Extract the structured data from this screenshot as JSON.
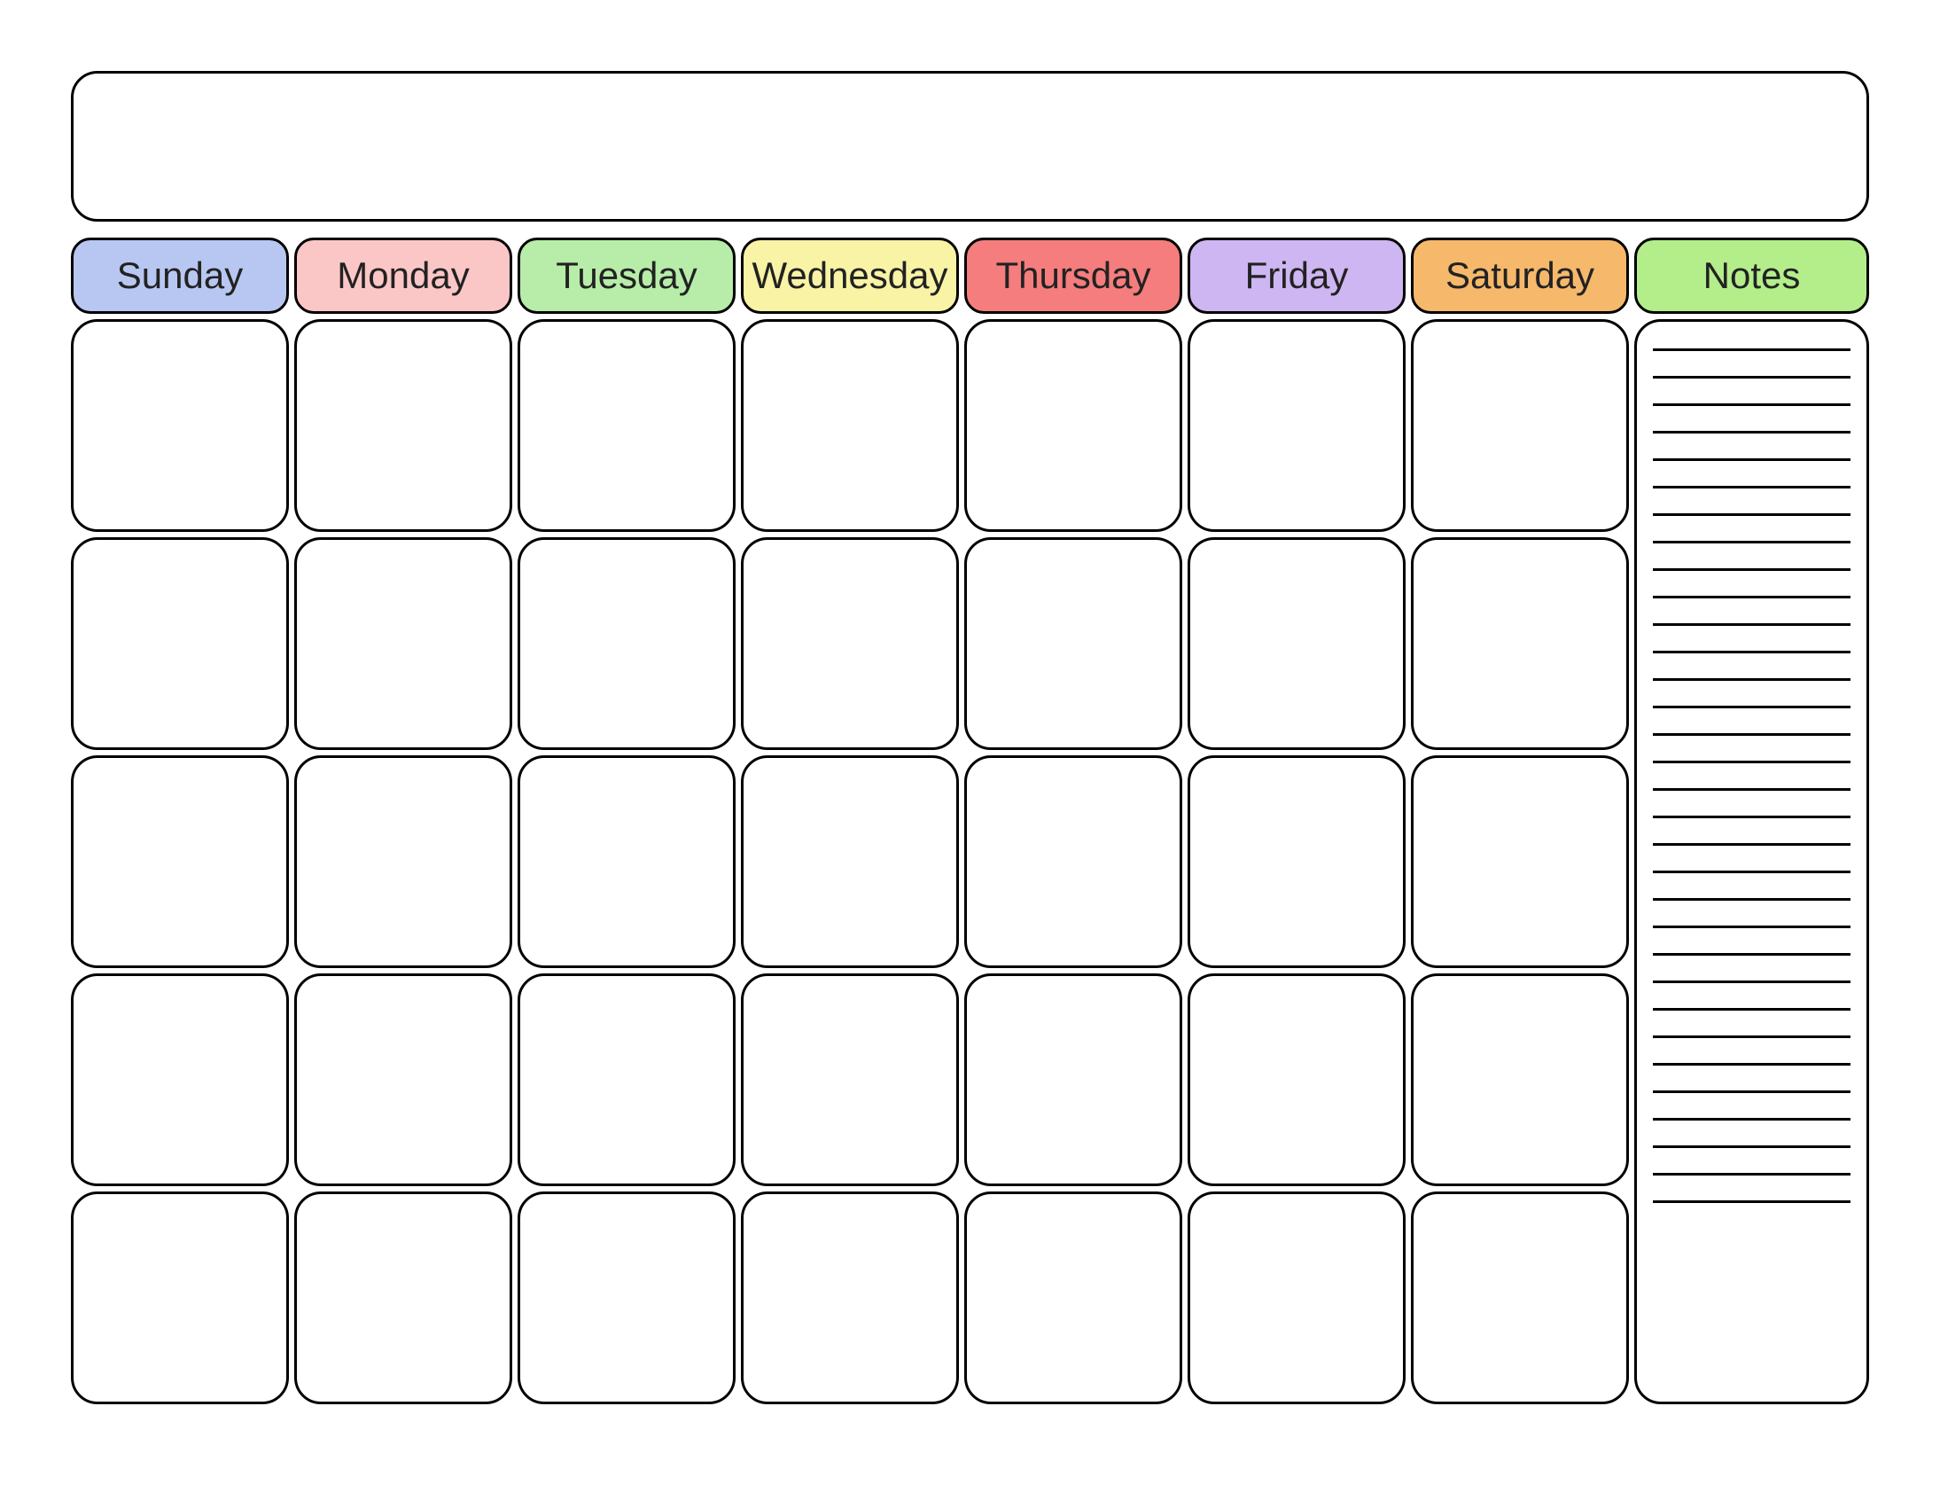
{
  "headers": {
    "days": [
      {
        "label": "Sunday",
        "color": "#b8c7f2"
      },
      {
        "label": "Monday",
        "color": "#fbc7c6"
      },
      {
        "label": "Tuesday",
        "color": "#b7eda9"
      },
      {
        "label": "Wednesday",
        "color": "#f9f3a6"
      },
      {
        "label": "Thursday",
        "color": "#f57d7d"
      },
      {
        "label": "Friday",
        "color": "#ceb6f2"
      },
      {
        "label": "Saturday",
        "color": "#f6b86b"
      }
    ],
    "notes": {
      "label": "Notes",
      "color": "#b4ee8b"
    }
  },
  "grid": {
    "rows": 5,
    "cols": 7
  },
  "notes_lines": 32
}
